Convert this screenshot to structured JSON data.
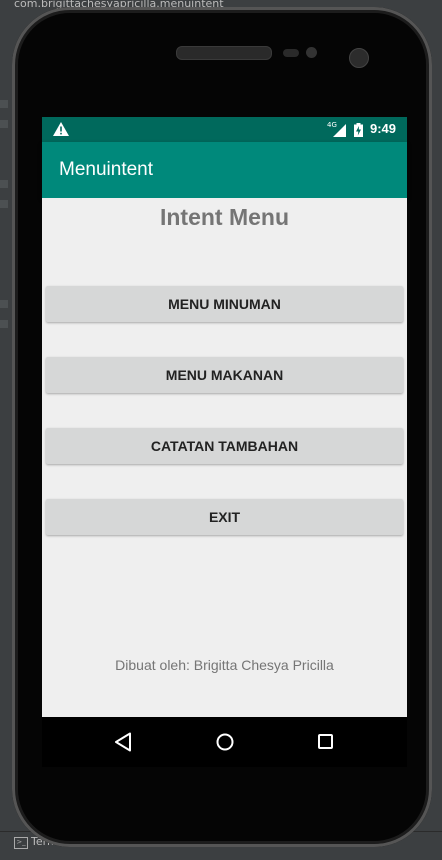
{
  "ide": {
    "project_path": "com.brigittachesyapricilla.menuintent",
    "bottom_tab": "Terminal"
  },
  "statusbar": {
    "network": "4G",
    "time": "9:49"
  },
  "appbar": {
    "title": "Menuintent"
  },
  "main": {
    "title": "Intent Menu",
    "buttons": [
      {
        "label": "MENU MINUMAN"
      },
      {
        "label": "MENU MAKANAN"
      },
      {
        "label": "CATATAN TAMBAHAN"
      },
      {
        "label": "EXIT"
      }
    ],
    "credit": "Dibuat oleh: Brigitta Chesya Pricilla"
  },
  "navbar": {
    "icons": [
      "back-icon",
      "home-icon",
      "recent-apps-icon"
    ]
  },
  "colors": {
    "statusbar": "#00695c",
    "appbar": "#00897b",
    "button": "#d6d7d7",
    "content_bg": "#efefef"
  }
}
